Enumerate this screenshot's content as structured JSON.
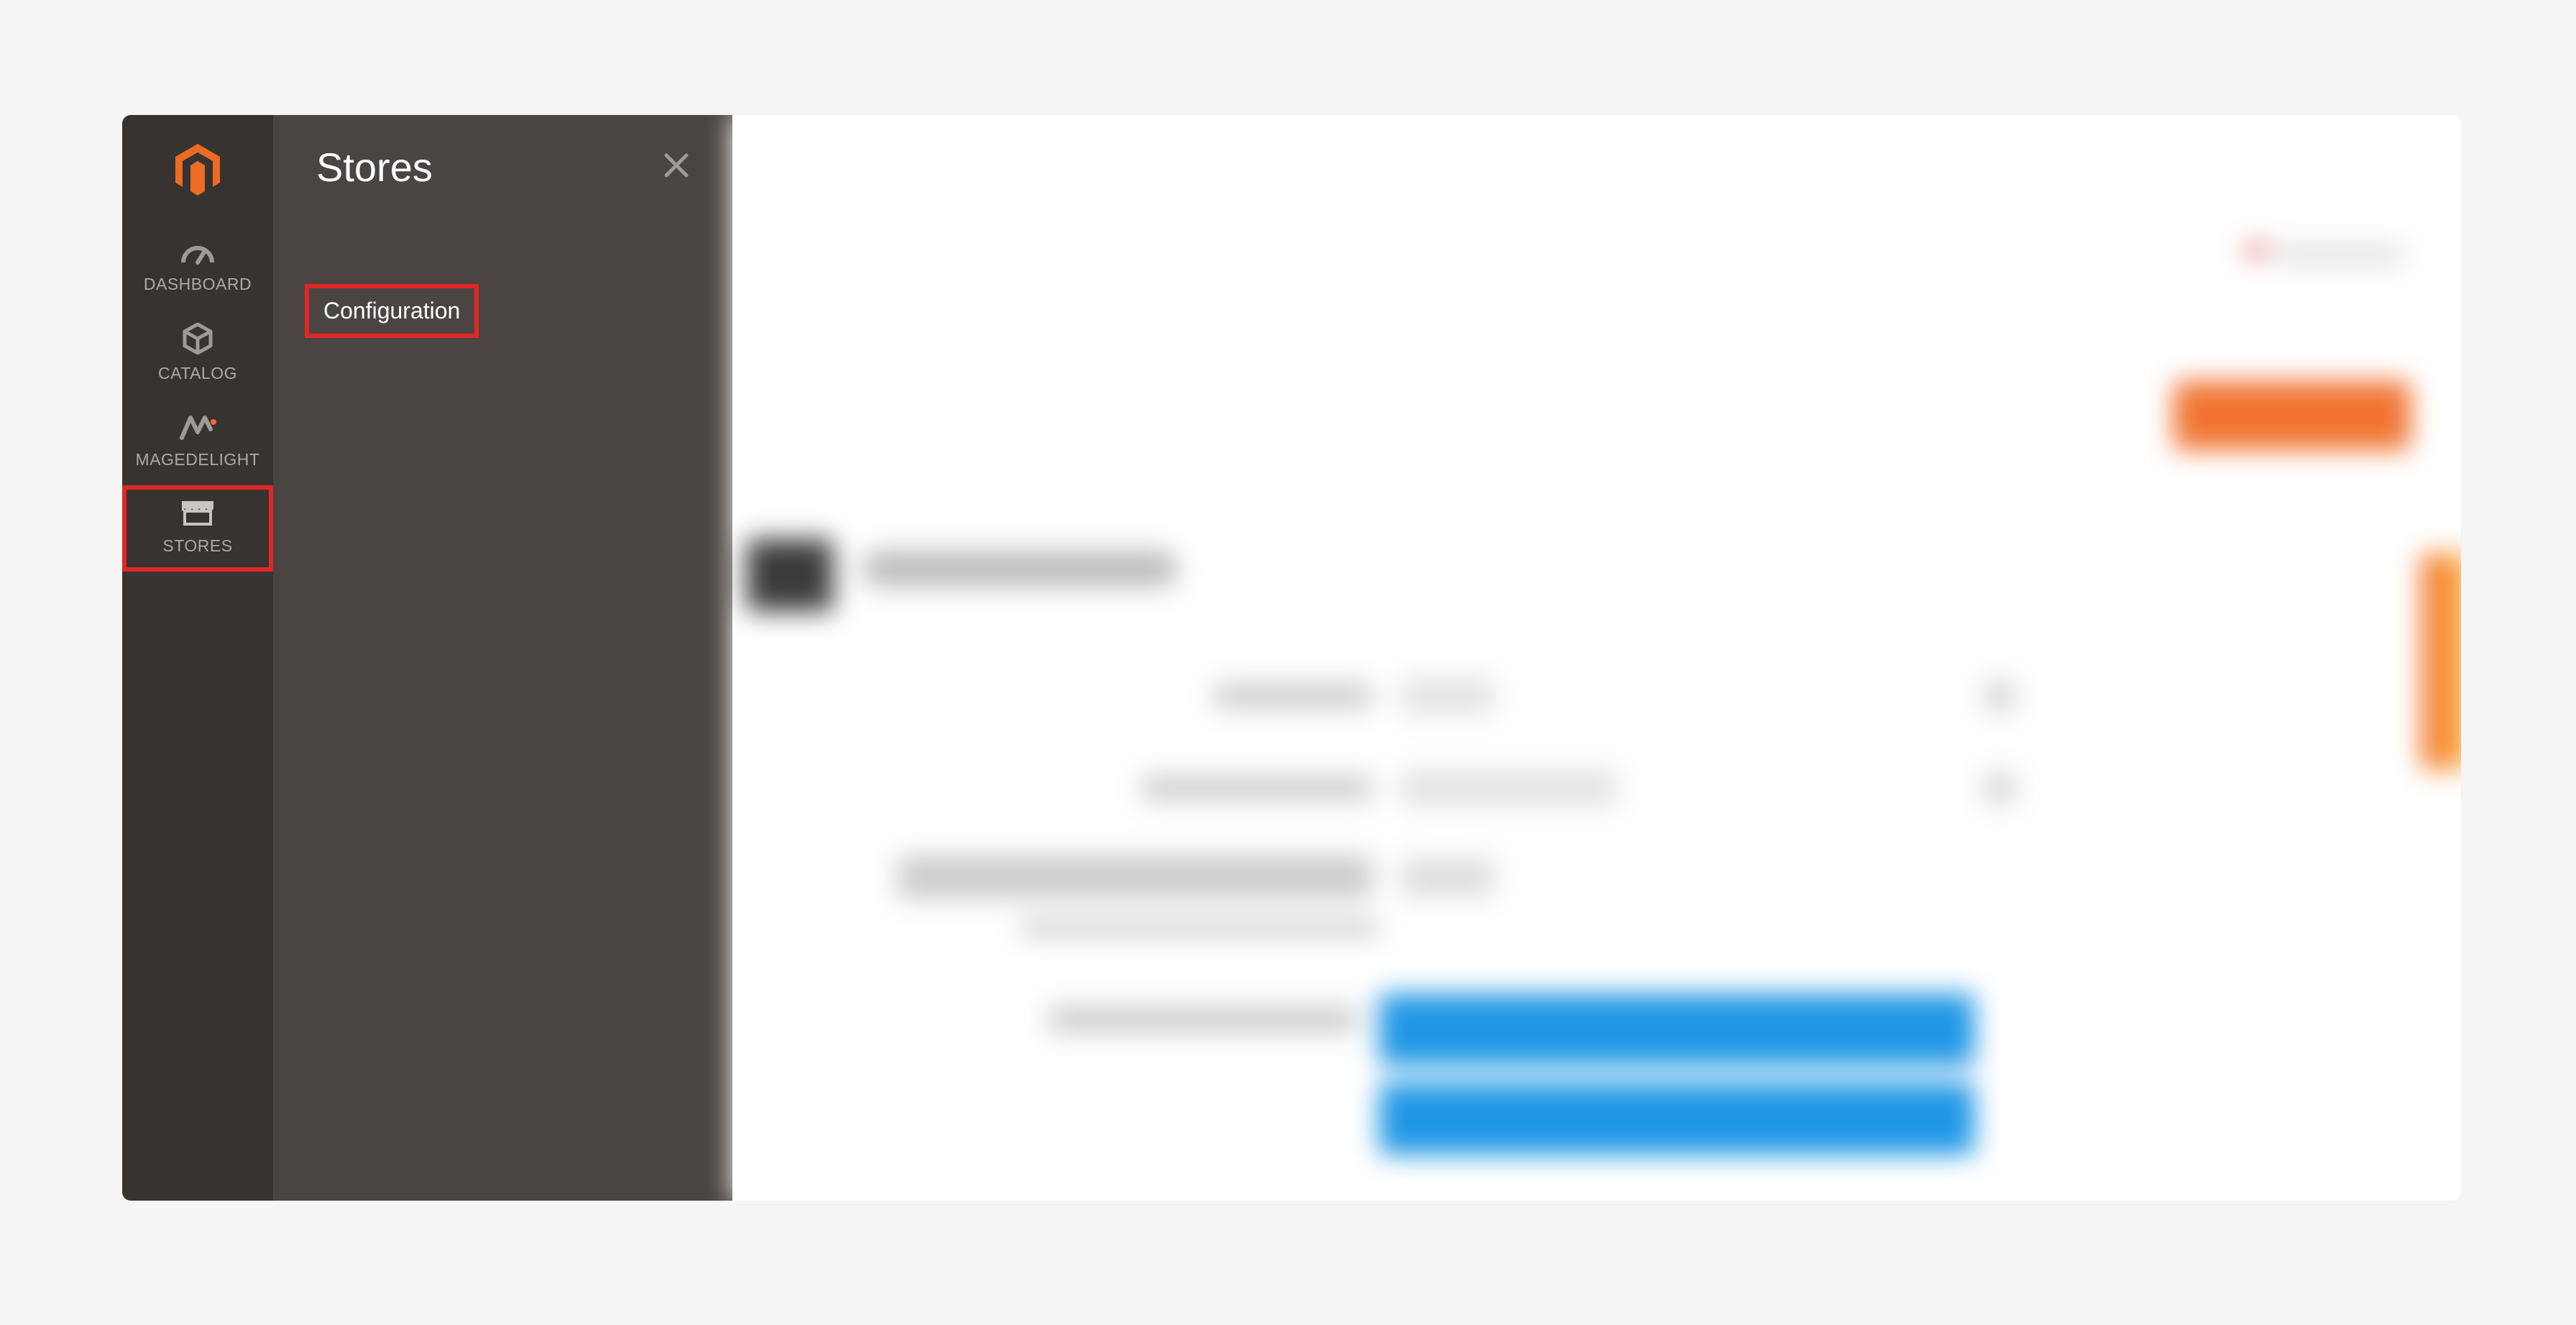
{
  "sidebar": {
    "items": [
      {
        "key": "dashboard",
        "label": "DASHBOARD"
      },
      {
        "key": "catalog",
        "label": "CATALOG"
      },
      {
        "key": "magedelight",
        "label": "MAGEDELIGHT"
      },
      {
        "key": "stores",
        "label": "STORES"
      }
    ],
    "activeIndex": 3
  },
  "flyout": {
    "title": "Stores",
    "link": "Configuration"
  },
  "colors": {
    "highlight": "#e22626",
    "accent": "#f07432",
    "sidebarBg": "#373330",
    "flyoutBg": "#4a4542"
  }
}
